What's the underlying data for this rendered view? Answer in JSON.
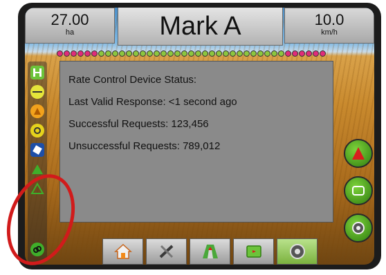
{
  "header": {
    "left_value": "27.00",
    "left_unit": "ha",
    "title": "Mark A",
    "right_value": "10.0",
    "right_unit": "km/h"
  },
  "led_colors": [
    "#e02c7a",
    "#e02c7a",
    "#e02c7a",
    "#e02c7a",
    "#e02c7a",
    "#e02c7a",
    "#8cc63f",
    "#8cc63f",
    "#8cc63f",
    "#8cc63f",
    "#8cc63f",
    "#8cc63f",
    "#8cc63f",
    "#8cc63f",
    "#8cc63f",
    "#8cc63f",
    "#8cc63f",
    "#8cc63f",
    "#8cc63f",
    "#8cc63f",
    "#8cc63f",
    "#8cc63f",
    "#8cc63f",
    "#8cc63f",
    "#8cc63f",
    "#8cc63f",
    "#8cc63f",
    "#8cc63f",
    "#8cc63f",
    "#8cc63f",
    "#8cc63f",
    "#8cc63f",
    "#8cc63f",
    "#e02c7a",
    "#e02c7a",
    "#e02c7a",
    "#e02c7a",
    "#e02c7a",
    "#e02c7a"
  ],
  "status_panel": {
    "heading": "Rate Control Device Status:",
    "last_response": "Last Valid Response: <1 second ago",
    "successful": "Successful Requests: 123,456",
    "unsuccessful": "Unsuccessful Requests: 789,012"
  },
  "left_toolbar": [
    "section-control-icon",
    "boundary-icon",
    "marker-icon",
    "guidance-mode-icon",
    "steering-icon",
    "nudge-icon",
    "implement-icon",
    "external-connection-icon"
  ],
  "right_toolbar": [
    "vehicle-view-icon",
    "map-view-icon",
    "rate-control-icon"
  ],
  "bottom_tabs": [
    "home-tab",
    "tools-tab",
    "guidance-tab",
    "map-tab",
    "rate-control-tab"
  ],
  "colors": {
    "accent_green": "#8cc63f",
    "highlight_red": "#d11b1b",
    "panel_gray": "#8a8a8a"
  }
}
